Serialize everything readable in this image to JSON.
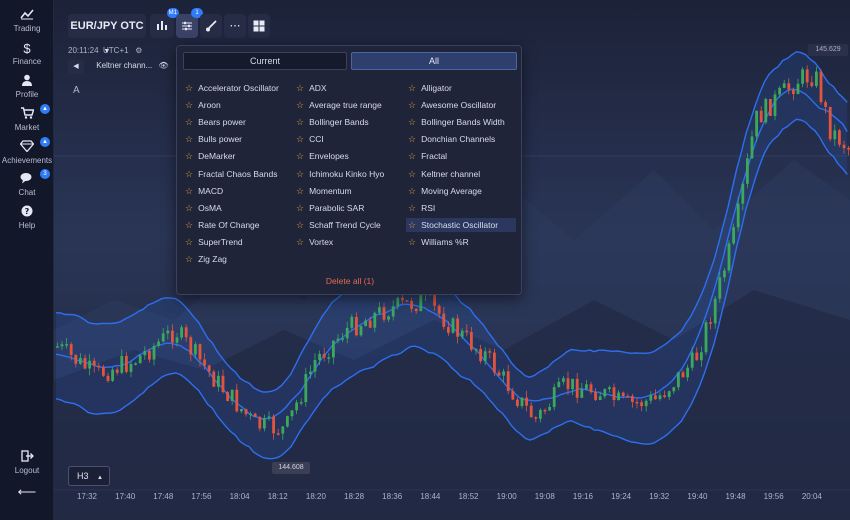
{
  "sidebar": {
    "items": [
      {
        "label": "Trading",
        "icon": "trading-chart-icon"
      },
      {
        "label": "Finance",
        "icon": "dollar-icon"
      },
      {
        "label": "Profile",
        "icon": "profile-icon"
      },
      {
        "label": "Market",
        "icon": "cart-icon"
      },
      {
        "label": "Achievements",
        "icon": "diamond-icon"
      },
      {
        "label": "Chat",
        "icon": "chat-icon",
        "badge": "3"
      },
      {
        "label": "Help",
        "icon": "help-icon"
      }
    ],
    "logout_label": "Logout"
  },
  "toolbar": {
    "asset": "EUR/JPY OTC",
    "chart_type_badge": "M1",
    "indicators_badge": "1"
  },
  "chart": {
    "time": "20:11:24",
    "timezone": "UTC+1",
    "indicator_label": "Keltner chann...",
    "letter": "A",
    "price_top": "145.629",
    "price_bottom": "144.608",
    "timeframe": "H3",
    "x_labels": [
      "17:32",
      "17:40",
      "17:48",
      "17:56",
      "18:04",
      "18:12",
      "18:20",
      "18:28",
      "18:36",
      "18:44",
      "18:52",
      "19:00",
      "19:08",
      "19:16",
      "19:24",
      "19:32",
      "19:40",
      "19:48",
      "19:56",
      "20:04"
    ]
  },
  "popup": {
    "tab_current": "Current",
    "tab_all": "All",
    "columns": [
      [
        "Accelerator Oscillator",
        "Aroon",
        "Bears power",
        "Bulls power",
        "DeMarker",
        "Fractal Chaos Bands",
        "MACD",
        "OsMA",
        "Rate Of Change",
        "SuperTrend",
        "Zig Zag"
      ],
      [
        "ADX",
        "Average true range",
        "Bollinger Bands",
        "CCI",
        "Envelopes",
        "Ichimoku Kinko Hyo",
        "Momentum",
        "Parabolic SAR",
        "Schaff Trend Cycle",
        "Vortex"
      ],
      [
        "Alligator",
        "Awesome Oscillator",
        "Bollinger Bands Width",
        "Donchian Channels",
        "Fractal",
        "Keltner channel",
        "Moving Average",
        "RSI",
        "Stochastic Oscillator",
        "Williams %R"
      ]
    ],
    "highlighted": "Stochastic Oscillator",
    "delete_all": "Delete all (1)"
  },
  "colors": {
    "bull": "#3ca85a",
    "bear": "#e2553c",
    "band": "#2d6ff0",
    "accent": "#2f7cf6"
  }
}
